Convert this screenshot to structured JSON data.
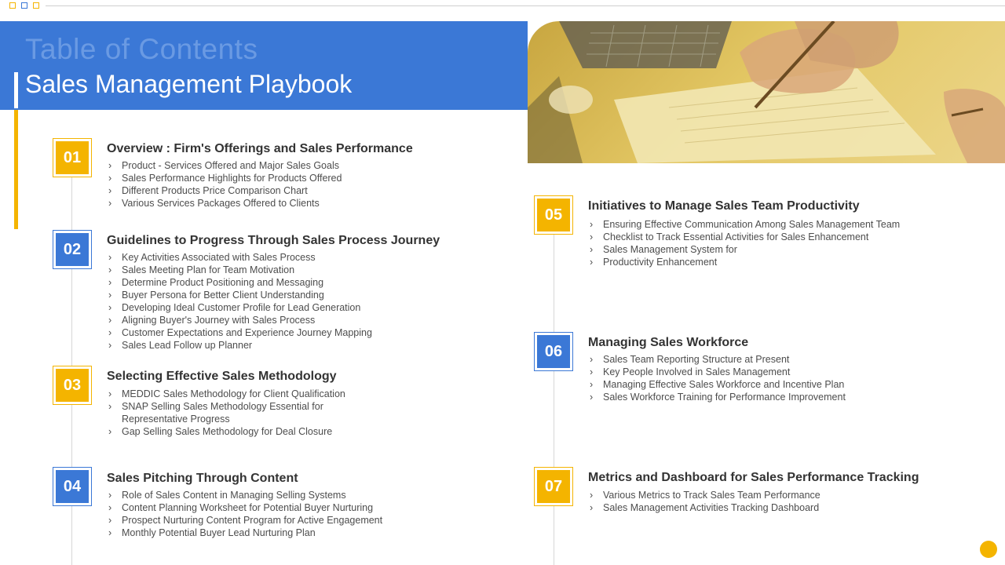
{
  "header": {
    "toc_title": "Table of Contents",
    "main_title": "Sales Management Playbook"
  },
  "sections": [
    {
      "number": "01",
      "title": "Overview : Firm's Offerings and Sales Performance",
      "items": [
        "Product - Services Offered  and Major Sales Goals",
        "Sales Performance Highlights for Products Offered",
        "Different  Products Price Comparison Chart",
        "Various Services Packages Offered  to Clients"
      ]
    },
    {
      "number": "02",
      "title": "Guidelines to Progress Through Sales Process Journey",
      "items": [
        "Key Activities Associated with Sales Process",
        "Sales Meeting Plan for Team Motivation",
        "Determine Product Positioning and Messaging",
        "Buyer Persona for Better Client Understanding",
        "Developing  Ideal Customer Profile for Lead Generation",
        "Aligning Buyer's Journey  with Sales Process",
        "Customer Expectations and Experience Journey Mapping",
        "Sales Lead Follow up Planner"
      ]
    },
    {
      "number": "03",
      "title": "Selecting Effective  Sales Methodology",
      "items": [
        "MEDDIC Sales Methodology  for Client Qualification",
        "SNAP Selling Sales Methodology  Essential for",
        "Representative  Progress",
        "Gap Selling Sales Methodology for Deal Closure"
      ]
    },
    {
      "number": "04",
      "title": "Sales Pitching Through Content",
      "items": [
        "Role of Sales Content  in Managing  Selling Systems",
        "Content Planning Worksheet for Potential Buyer Nurturing",
        "Prospect Nurturing Content Program for Active Engagement",
        "Monthly Potential Buyer Lead Nurturing Plan"
      ]
    },
    {
      "number": "05",
      "title": "Initiatives to Manage Sales Team Productivity",
      "items": [
        "Ensuring Effective Communication Among Sales Management Team",
        "Checklist to Track Essential Activities for Sales Enhancement",
        "Sales Management System for",
        "Productivity Enhancement"
      ]
    },
    {
      "number": "06",
      "title": "Managing Sales Workforce",
      "items": [
        "Sales Team Reporting  Structure at Present",
        "Key People Involved  in Sales Management",
        "Managing Effective  Sales Workforce and Incentive  Plan",
        "Sales Workforce Training  for Performance  Improvement"
      ]
    },
    {
      "number": "07",
      "title": "Metrics  and Dashboard for Sales Performance Tracking",
      "items": [
        "Various Metrics to Track Sales Team Performance",
        "Sales Management  Activities Tracking Dashboard"
      ]
    }
  ],
  "colors": {
    "brand_blue": "#3b78d6",
    "brand_yellow": "#f4b400"
  },
  "icons": [
    "square-outline-icon",
    "chevron-right-icon",
    "circle-dot-icon"
  ]
}
